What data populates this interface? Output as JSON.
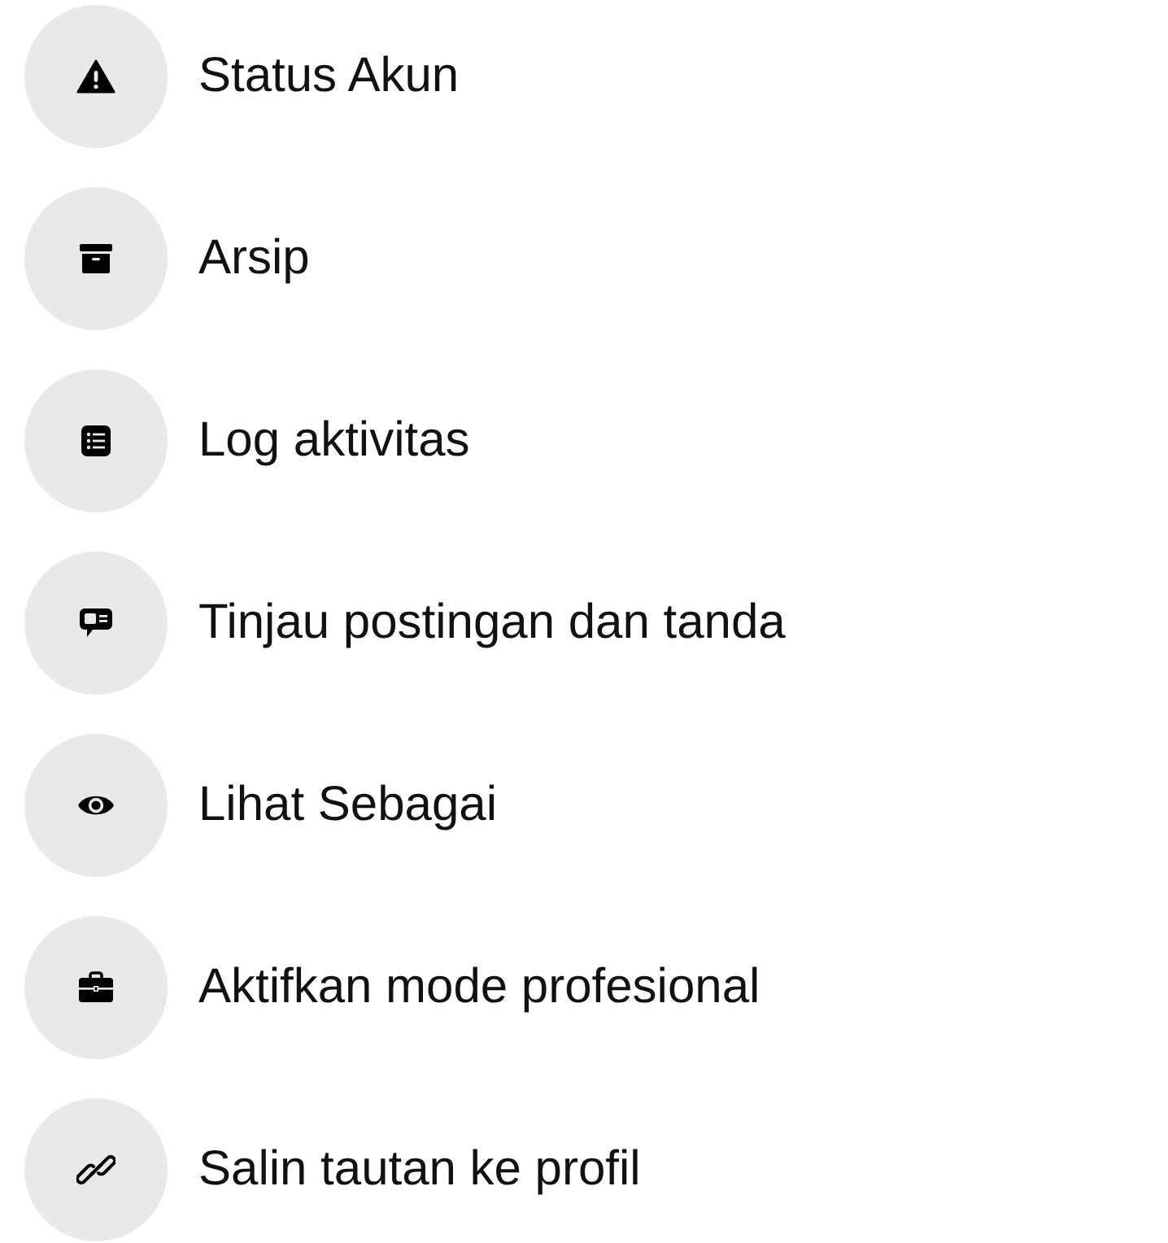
{
  "menu_items": [
    {
      "kind": "warning",
      "label": "Status Akun"
    },
    {
      "kind": "archive",
      "label": "Arsip"
    },
    {
      "kind": "list",
      "label": "Log aktivitas"
    },
    {
      "kind": "review",
      "label": "Tinjau postingan dan tanda"
    },
    {
      "kind": "eye",
      "label": "Lihat Sebagai"
    },
    {
      "kind": "briefcase",
      "label": "Aktifkan mode profesional"
    },
    {
      "kind": "link",
      "label": "Salin tautan ke profil"
    }
  ]
}
